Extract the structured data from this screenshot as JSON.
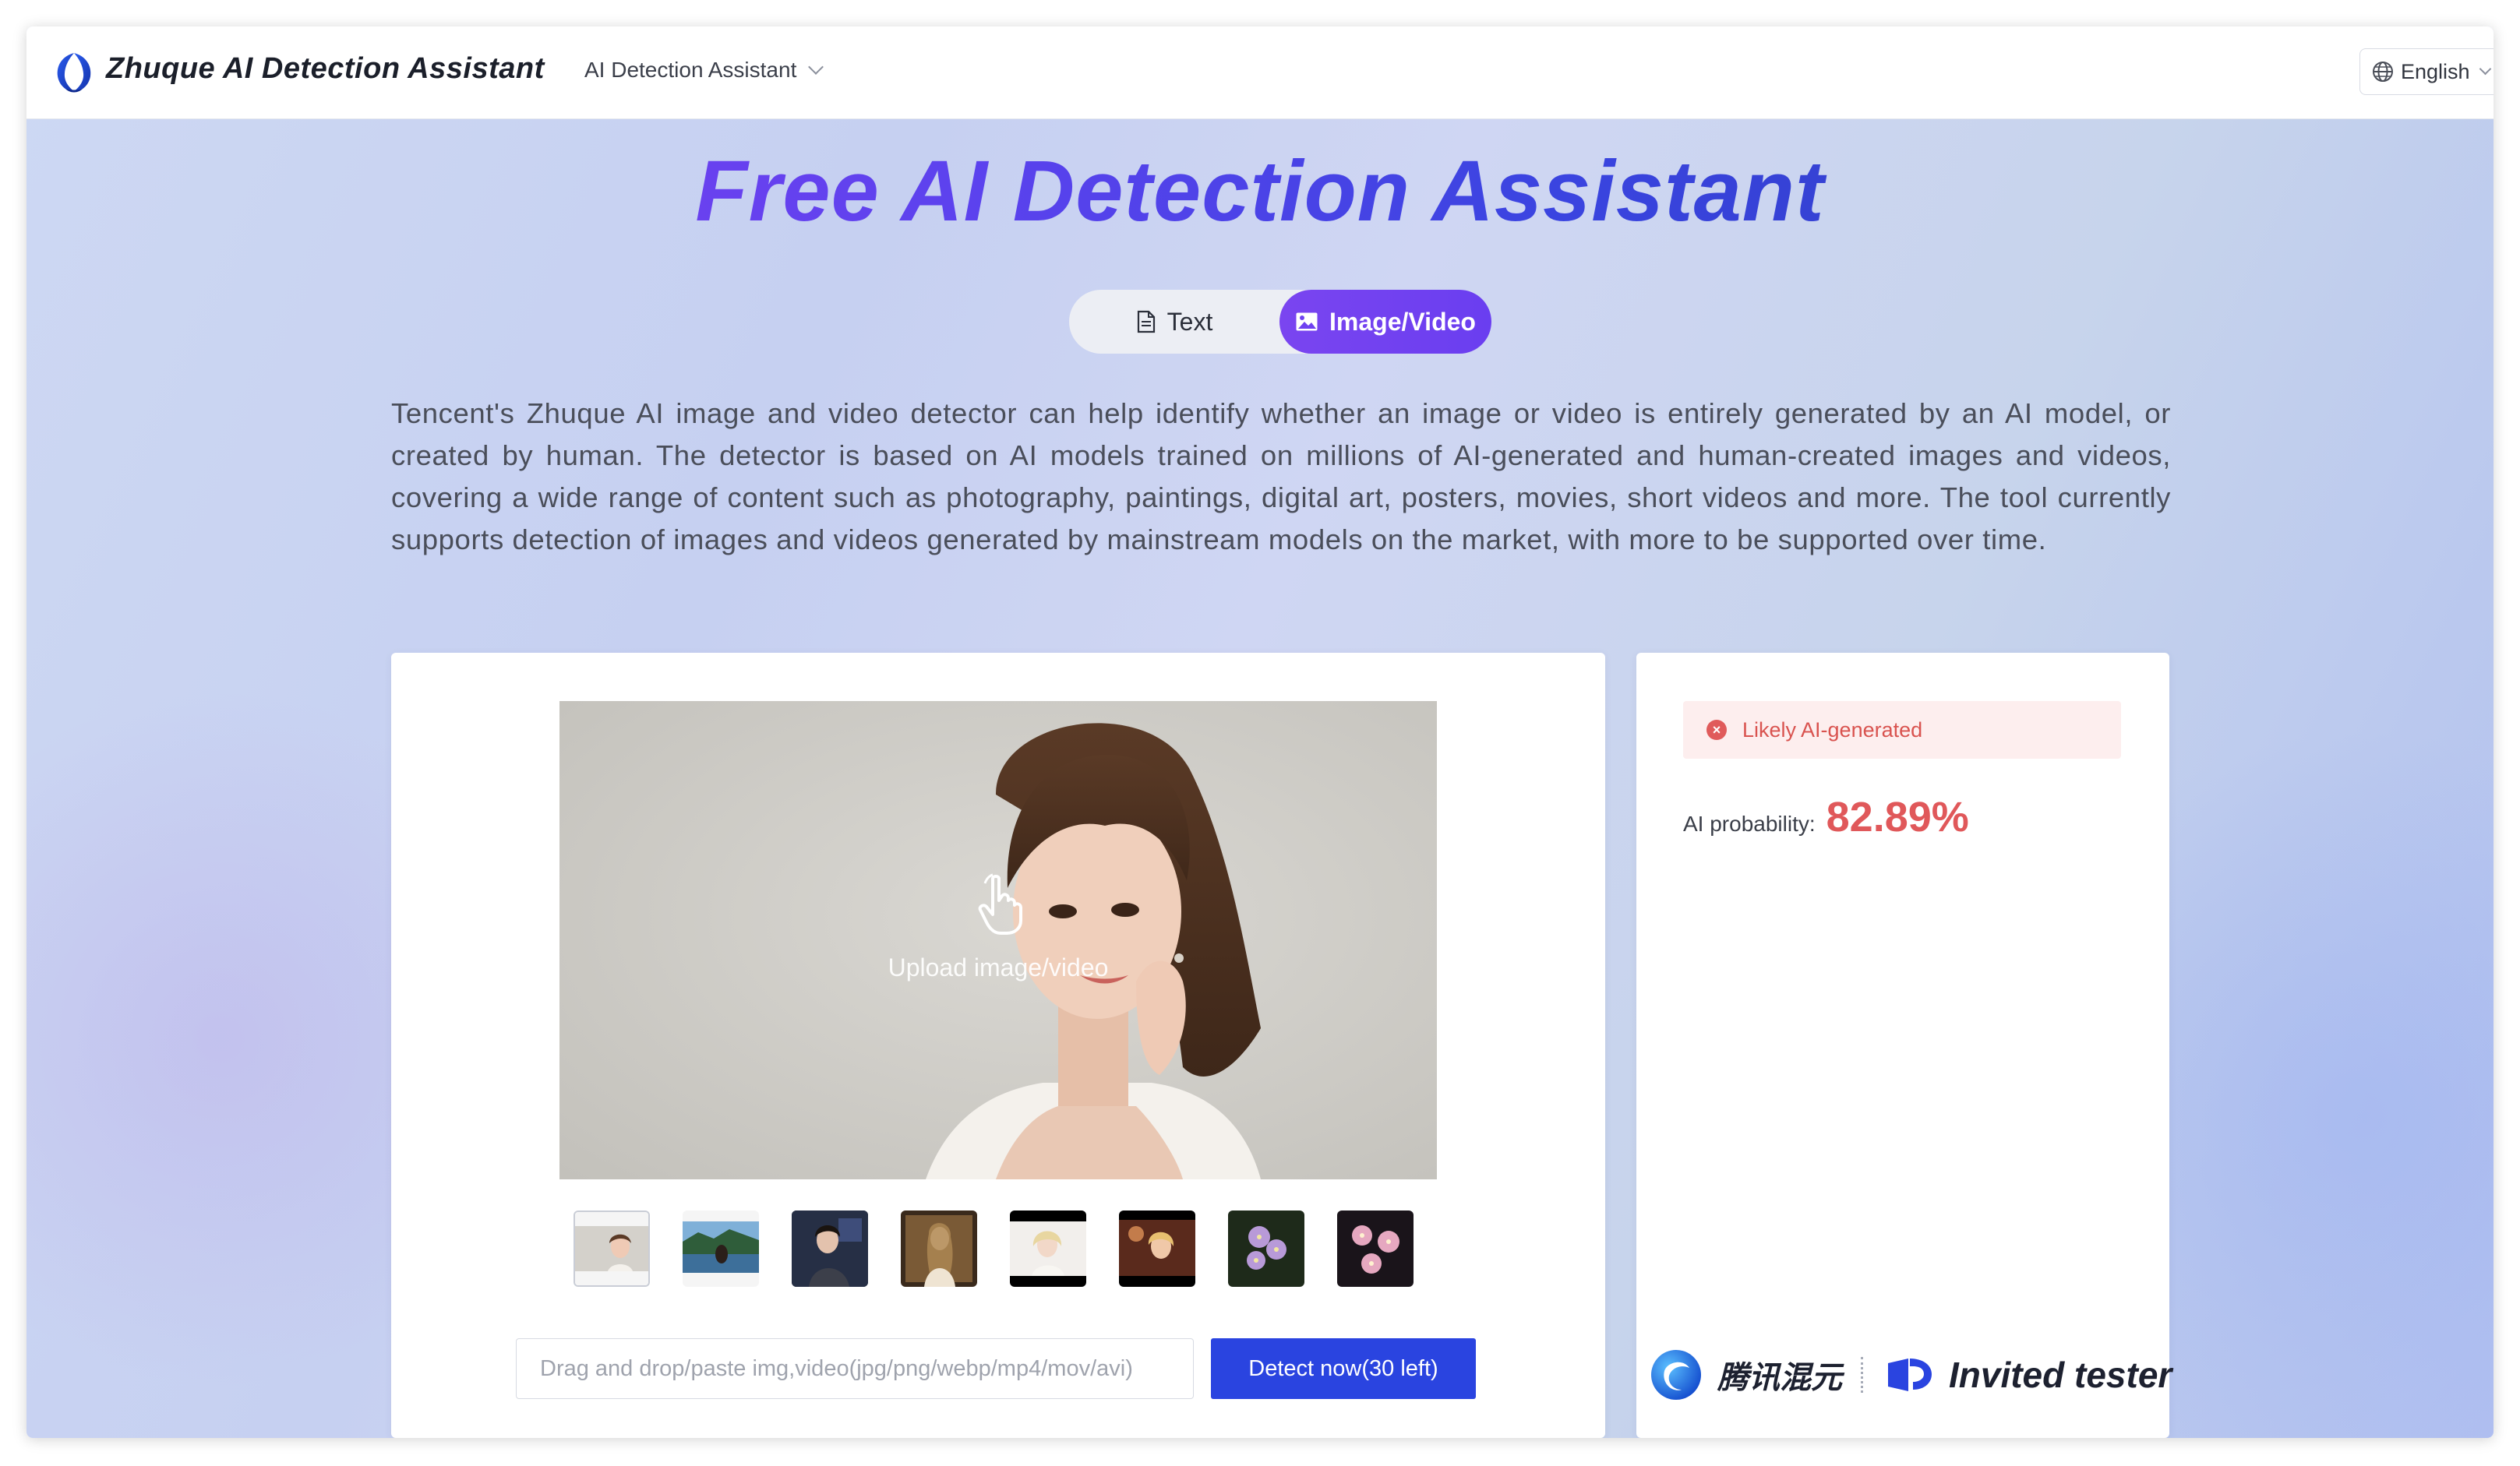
{
  "header": {
    "brand": "Zhuque AI Detection Assistant",
    "nav_selector": "AI Detection Assistant",
    "language": "English"
  },
  "hero": {
    "title": "Free AI Detection Assistant"
  },
  "tabs": [
    {
      "label": "Text",
      "active": false
    },
    {
      "label": "Image/Video",
      "active": true
    }
  ],
  "description": "Tencent's Zhuque AI image and video detector can help identify whether an image or video is entirely generated by an AI model, or created by human. The detector is based on AI models trained on millions of AI-generated and human-created images and videos, covering a wide range of content such as photography, paintings, digital art, posters, movies, short videos and more. The tool currently supports detection of images and videos generated by mainstream models on the market, with more to be supported over time.",
  "uploader": {
    "upload_label": "Upload image/video",
    "input_placeholder": "Drag and drop/paste img,video(jpg/png/webp/mp4/mov/avi)",
    "detect_button": "Detect now(30 left)",
    "selected_thumbnail": 1
  },
  "result": {
    "verdict": "Likely AI-generated",
    "probability_label": "AI probability:",
    "probability_value": "82.89%"
  },
  "footer": {
    "partner_name": "腾讯混元",
    "badge": "Invited tester"
  },
  "colors": {
    "accent_purple": "#7a45f0",
    "button_blue": "#2a44e0",
    "danger": "#e0585a"
  }
}
